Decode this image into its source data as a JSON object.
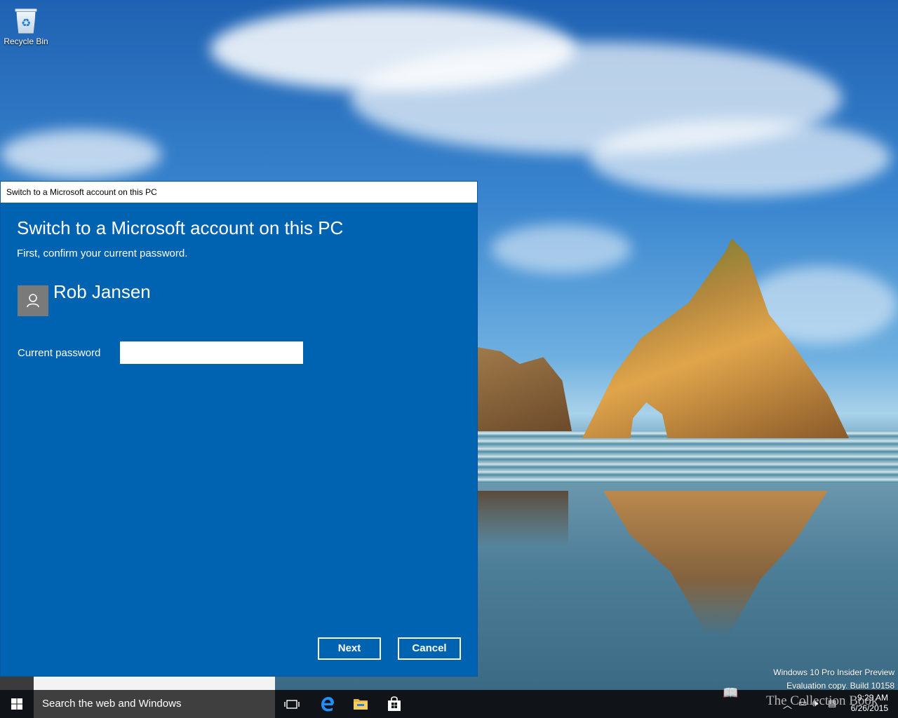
{
  "desktop": {
    "icons": [
      {
        "label": "Recycle Bin",
        "icon": "recycle-bin-icon"
      }
    ],
    "watermark": {
      "line1": "Windows 10 Pro Insider Preview",
      "line2": "Evaluation copy. Build 10158"
    }
  },
  "dialog": {
    "window_title": "Switch to a Microsoft account on this PC",
    "heading": "Switch to a Microsoft account on this PC",
    "subtitle": "First, confirm your current password.",
    "user": {
      "name": "Rob Jansen",
      "avatar_icon": "user-avatar-icon"
    },
    "password": {
      "label": "Current password",
      "value": "",
      "placeholder": ""
    },
    "buttons": {
      "next": "Next",
      "cancel": "Cancel"
    },
    "colors": {
      "background": "#0063b1",
      "titlebar": "#ffffff"
    }
  },
  "taskbar": {
    "start_icon": "windows-start-icon",
    "search_text": "Search the web and Windows",
    "pinned": [
      {
        "name": "task-view-icon"
      },
      {
        "name": "edge-icon"
      },
      {
        "name": "file-explorer-icon"
      },
      {
        "name": "store-icon"
      }
    ],
    "tray_icons": [
      "show-hidden-icons-icon",
      "network-icon",
      "volume-icon",
      "action-center-icon"
    ],
    "clock": {
      "time": "9:29 AM",
      "date": "6/26/2015"
    },
    "overlay_brand": "The Collection Book",
    "colors": {
      "background": "#101418",
      "search_background": "#3f3f3f"
    }
  }
}
